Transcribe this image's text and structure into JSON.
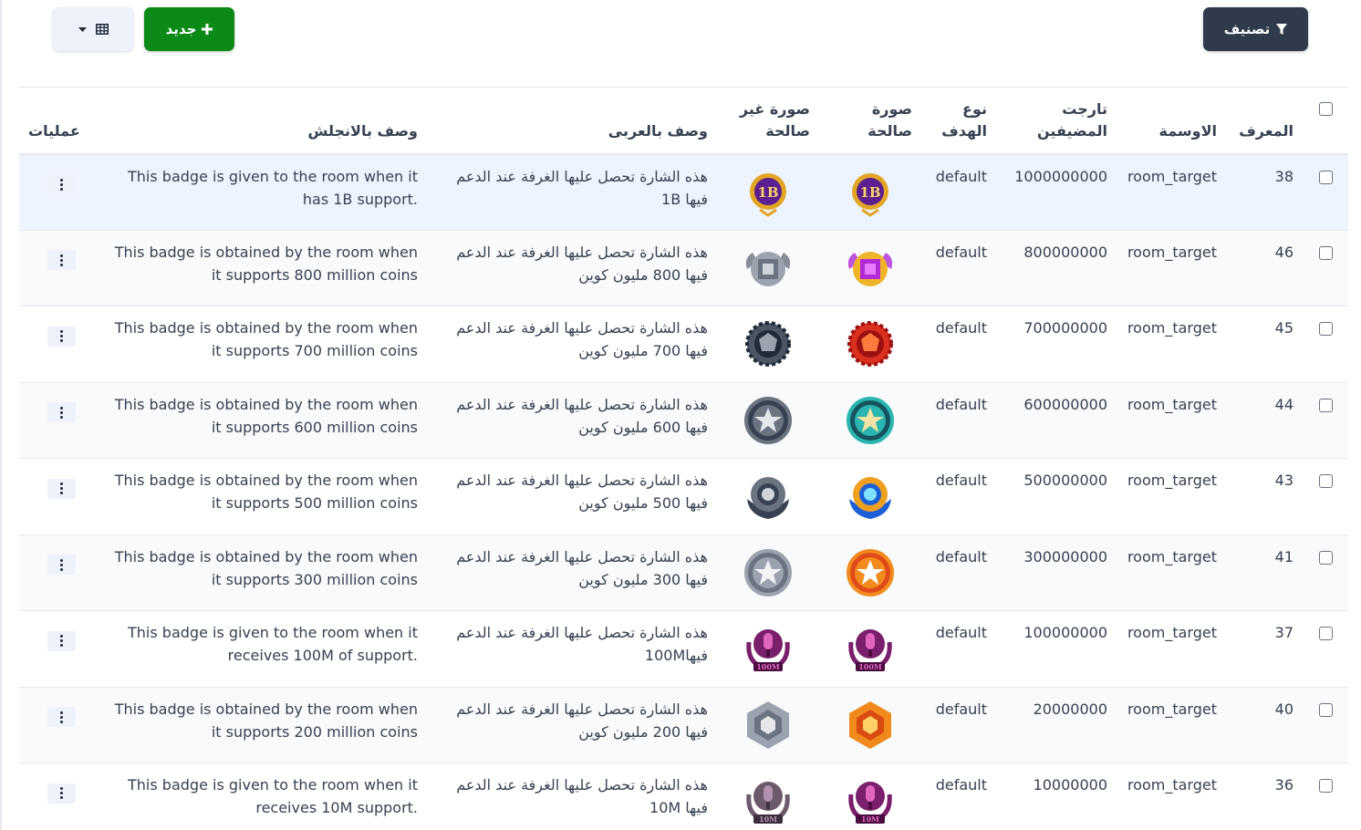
{
  "toolbar": {
    "filter_label": "تصنيف",
    "new_label": "جديد",
    "filter_icon": "filter-icon",
    "new_icon": "plus-icon",
    "columns_icon": "table-icon",
    "dropdown_icon": "caret-down-icon"
  },
  "table": {
    "headers": {
      "id": "المعرف",
      "badge": "الاوسمة",
      "target_line1": "تارجت",
      "target_line2": "المضيفين",
      "type_line1": "نوع",
      "type_line2": "الهدف",
      "valid_img_line1": "صورة",
      "valid_img_line2": "صالحة",
      "invalid_img_line1": "صورة غير",
      "invalid_img_line2": "صالحة",
      "desc_ar": "وصف بالعربى",
      "desc_en": "وصف بالانجلش",
      "ops": "عمليات"
    },
    "rows": [
      {
        "id": "38",
        "badge": "room_target",
        "target": "1000000000",
        "type": "default",
        "desc_ar": "هذه الشارة تحصل عليها الغرفة عند الدعم فيها 1B",
        "desc_en": "This badge is given to the room when it has 1B support.",
        "valid_badge": "badge-1b-gold",
        "invalid_badge": "badge-1b-gold",
        "label": "1B"
      },
      {
        "id": "46",
        "badge": "room_target",
        "target": "800000000",
        "type": "default",
        "desc_ar": "هذه الشارة تحصل عليها الغرفة عند الدعم فيها 800 مليون كوين",
        "desc_en": "This badge is obtained by the room when it supports 800 million coins",
        "valid_badge": "badge-purple-gem",
        "invalid_badge": "badge-gray-gem"
      },
      {
        "id": "45",
        "badge": "room_target",
        "target": "700000000",
        "type": "default",
        "desc_ar": "هذه الشارة تحصل عليها الغرفة عند الدعم فيها 700 مليون كوين",
        "desc_en": "This badge is obtained by the room when it supports 700 million coins",
        "valid_badge": "badge-red-gem",
        "invalid_badge": "badge-dark-gem"
      },
      {
        "id": "44",
        "badge": "room_target",
        "target": "600000000",
        "type": "default",
        "desc_ar": "هذه الشارة تحصل عليها الغرفة عند الدعم فيها 600 مليون كوين",
        "desc_en": "This badge is obtained by the room when it supports 600 million coins",
        "valid_badge": "badge-teal-star",
        "invalid_badge": "badge-gray-star"
      },
      {
        "id": "43",
        "badge": "room_target",
        "target": "500000000",
        "type": "default",
        "desc_ar": "هذه الشارة تحصل عليها الغرفة عند الدعم فيها 500 مليون كوين",
        "desc_en": "This badge is obtained by the room when it supports 500 million coins",
        "valid_badge": "badge-blue-orb",
        "invalid_badge": "badge-gray-orb"
      },
      {
        "id": "41",
        "badge": "room_target",
        "target": "300000000",
        "type": "default",
        "desc_ar": "هذه الشارة تحصل عليها الغرفة عند الدعم فيها 300 مليون كوين",
        "desc_en": "This badge is obtained by the room when it supports 300 million coins",
        "valid_badge": "badge-orange-star",
        "invalid_badge": "badge-silver-star"
      },
      {
        "id": "37",
        "badge": "room_target",
        "target": "100000000",
        "type": "default",
        "desc_ar": "هذه الشارة تحصل عليها الغرفة عند الدعم فيها100M",
        "desc_en": "This badge is given to the room when it receives 100M of support.",
        "valid_badge": "badge-mic-100m",
        "invalid_badge": "badge-mic-100m",
        "label": "100M"
      },
      {
        "id": "40",
        "badge": "room_target",
        "target": "20000000",
        "type": "default",
        "desc_ar": "هذه الشارة تحصل عليها الغرفة عند الدعم فيها 200 مليون كوين",
        "desc_en": "This badge is obtained by the room when it supports 200 million coins",
        "valid_badge": "badge-orange-hex",
        "invalid_badge": "badge-gray-hex"
      },
      {
        "id": "36",
        "badge": "room_target",
        "target": "10000000",
        "type": "default",
        "desc_ar": "هذه الشارة تحصل عليها الغرفة عند الدعم فيها 10M",
        "desc_en": "This badge is given to the room when it receives 10M support.",
        "valid_badge": "badge-mic-10m",
        "invalid_badge": "badge-mic-10m-gray",
        "label": "10M"
      }
    ]
  },
  "colors": {
    "filter_btn": "#2f3b4b",
    "new_btn": "#0b8a17",
    "columns_btn": "#eef2fb",
    "selected_row": "#eef4fe"
  }
}
